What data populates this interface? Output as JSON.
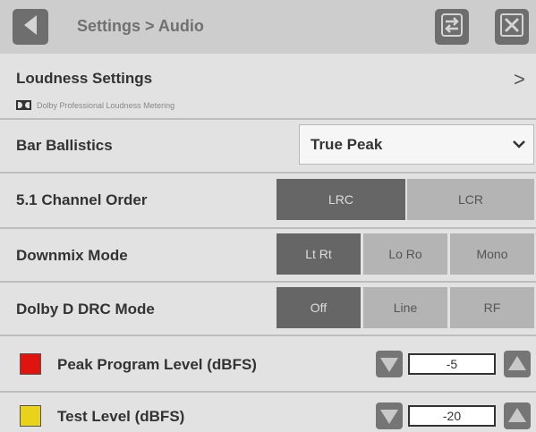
{
  "header": {
    "breadcrumb": "Settings > Audio",
    "icons": {
      "back": "back-arrow-icon",
      "swap": "swap-arrows-icon",
      "close": "close-x-icon"
    }
  },
  "loudness": {
    "title": "Loudness Settings",
    "subtitle": "Dolby Professional Loudness Metering",
    "chevron": ">"
  },
  "bar_ballistics": {
    "label": "Bar Ballistics",
    "value": "True Peak"
  },
  "channel_order": {
    "label": "5.1 Channel Order",
    "options": [
      "LRC",
      "LCR"
    ],
    "selected": "LRC"
  },
  "downmix": {
    "label": "Downmix Mode",
    "options": [
      "Lt Rt",
      "Lo Ro",
      "Mono"
    ],
    "selected": "Lt Rt"
  },
  "drc": {
    "label": "Dolby D DRC Mode",
    "options": [
      "Off",
      "Line",
      "RF"
    ],
    "selected": "Off"
  },
  "peak_level": {
    "label": "Peak Program Level (dBFS)",
    "value": "-5",
    "color": "#e0140f"
  },
  "test_level": {
    "label": "Test Level (dBFS)",
    "value": "-20",
    "color": "#e8d21a"
  }
}
